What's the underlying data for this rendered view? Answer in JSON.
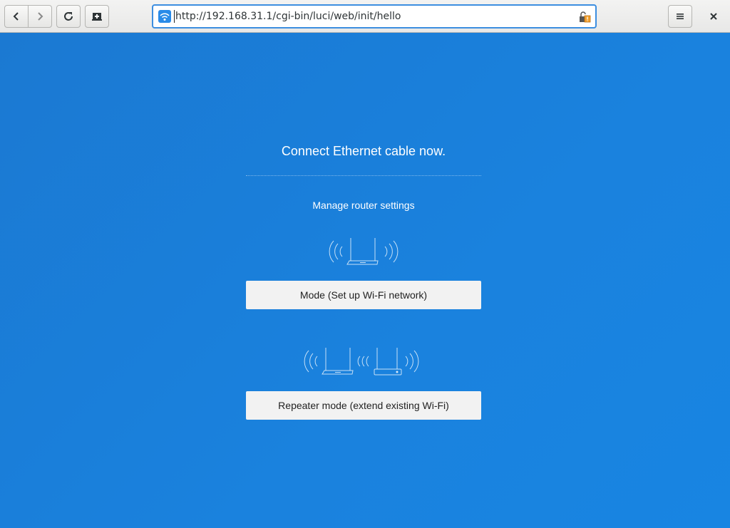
{
  "browser": {
    "url": "http://192.168.31.1/cgi-bin/luci/web/init/hello",
    "icons": {
      "back": "chevron-left-icon",
      "forward": "chevron-right-icon",
      "reload": "reload-icon",
      "new_tab": "new-tab-icon",
      "site": "wifi-icon",
      "lock": "insecure-lock-icon",
      "menu": "hamburger-menu-icon",
      "close": "close-icon"
    }
  },
  "page": {
    "title": "Connect Ethernet cable now.",
    "subtitle": "Manage router settings",
    "mode_button": "Mode (Set up Wi-Fi network)",
    "repeater_button": "Repeater mode (extend existing Wi-Fi)",
    "background_color": "#1a7fd8",
    "button_color": "#f2f2f2"
  }
}
